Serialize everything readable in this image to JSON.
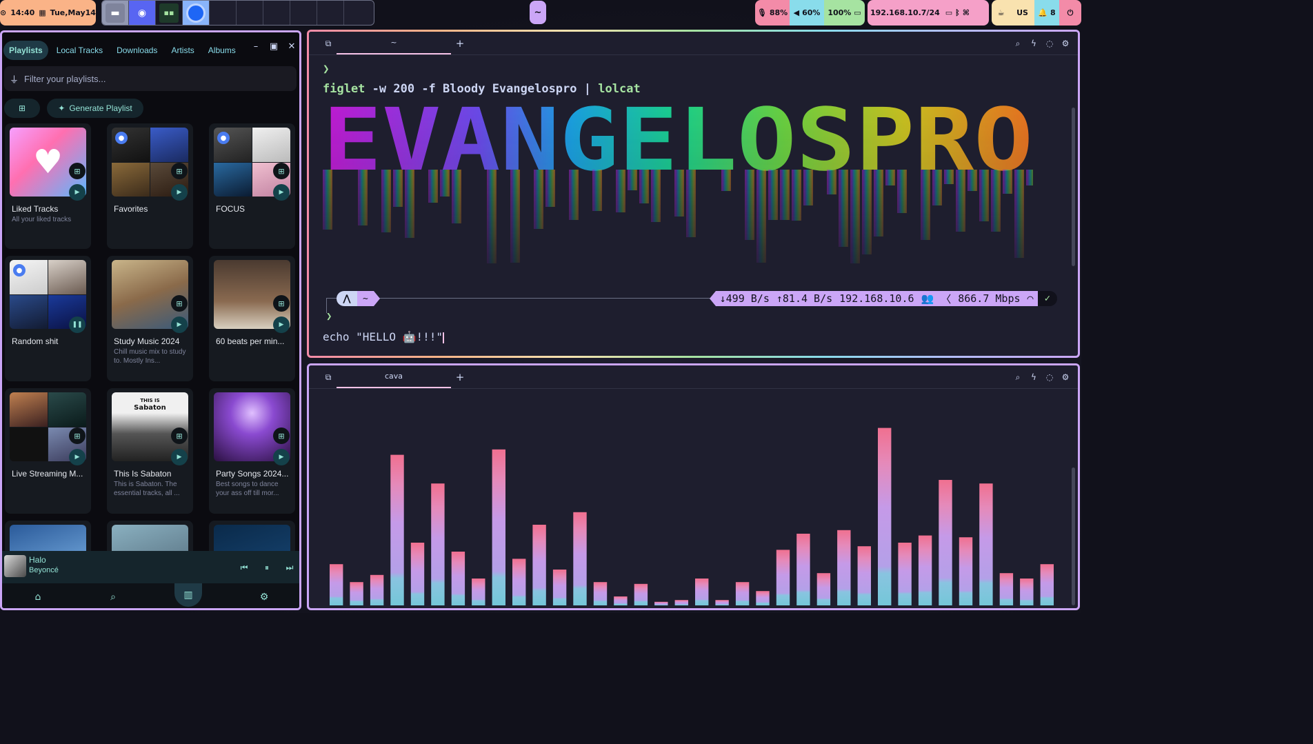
{
  "topbar": {
    "clock": {
      "time": "14:40",
      "date": "Tue,May14"
    },
    "center_label": "~",
    "mic": "88%",
    "volume": "60%",
    "battery": "100%",
    "ip": "192.168.10.7/24",
    "layout": "US",
    "notifications": "8",
    "colors": {
      "clock": "#fab387",
      "mic": "#f38ba8",
      "volume": "#89dceb",
      "battery": "#a6e3a1",
      "ip": "#f5a0c8",
      "misc": "#f9e2af"
    }
  },
  "spotify": {
    "tabs": [
      "Playlists",
      "Local Tracks",
      "Downloads",
      "Artists",
      "Albums"
    ],
    "active_tab": "Playlists",
    "filter_placeholder": "Filter your playlists...",
    "generate_label": "Generate Playlist",
    "playlists": [
      {
        "title": "Liked Tracks",
        "subtitle": "All your liked tracks"
      },
      {
        "title": "Favorites",
        "subtitle": ""
      },
      {
        "title": "FOCUS",
        "subtitle": ""
      },
      {
        "title": "Random shit",
        "subtitle": ""
      },
      {
        "title": "Study Music 2024",
        "subtitle": "Chill music mix to study to. Mostly Ins..."
      },
      {
        "title": "60 beats per min...",
        "subtitle": ""
      },
      {
        "title": "Live Streaming M...",
        "subtitle": ""
      },
      {
        "title": "This Is Sabaton",
        "subtitle": "This is Sabaton. The essential tracks, all ..."
      },
      {
        "title": "Party Songs 2024...",
        "subtitle": "Best songs to dance your ass off till mor..."
      }
    ],
    "sabaton_cover": {
      "this_is": "THIS IS",
      "name": "Sabaton"
    },
    "now_playing": {
      "song": "Halo",
      "artist": "Beyoncé"
    }
  },
  "terminal1": {
    "tab_label": "~",
    "command": {
      "bin": "figlet",
      "flags": "-w 200 -f",
      "args": "Bloody Evangelospro",
      "pipe": "|",
      "pipe_to": "lolcat"
    },
    "banner_text": "EVANGELOSPRO",
    "status": {
      "dir": "~",
      "down": "↓499 B/s",
      "up": "↑81.4 B/s",
      "ip": "192.168.10.6",
      "speed": "866.7 Mbps",
      "ok": "✓"
    },
    "echo_line": "echo \"HELLO 🤖!!!\""
  },
  "terminal2": {
    "tab_label": "cava",
    "bar_levels": [
      0.23,
      0.13,
      0.17,
      0.84,
      0.35,
      0.68,
      0.3,
      0.15,
      0.87,
      0.26,
      0.45,
      0.2,
      0.52,
      0.13,
      0.05,
      0.12,
      0.02,
      0.03,
      0.15,
      0.03,
      0.13,
      0.08,
      0.31,
      0.4,
      0.18,
      0.42,
      0.33,
      0.99,
      0.35,
      0.39,
      0.7,
      0.38,
      0.68,
      0.18,
      0.15,
      0.23
    ]
  }
}
